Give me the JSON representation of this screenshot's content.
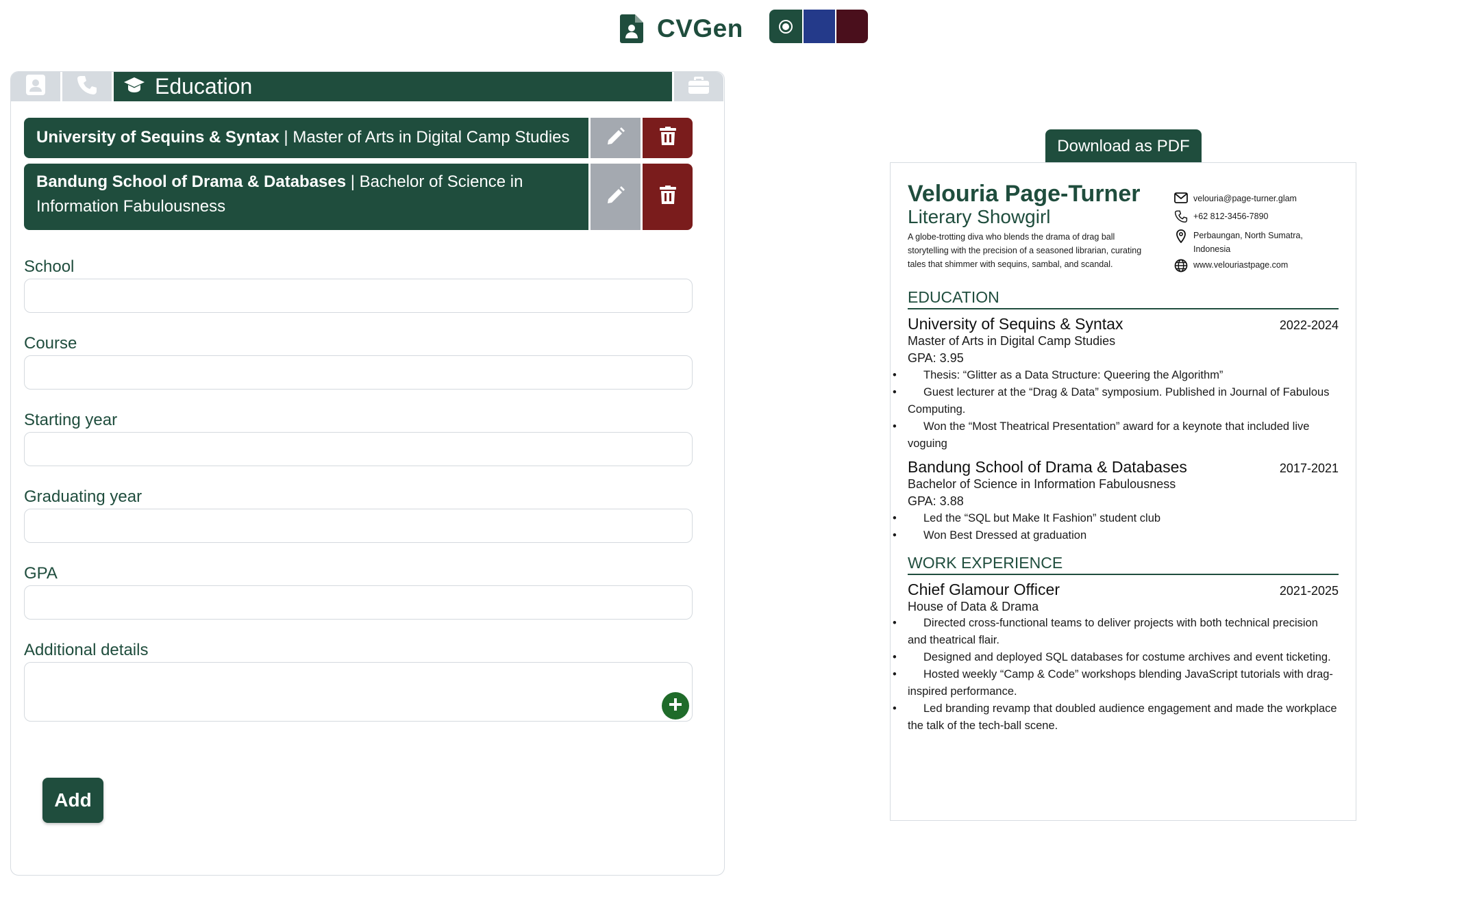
{
  "app": {
    "title": "CVGen",
    "icon": "file-person-icon",
    "themes": [
      {
        "name": "green",
        "color": "#1f4d3d",
        "selected": true
      },
      {
        "name": "blue",
        "color": "#243a8a",
        "selected": false
      },
      {
        "name": "maroon",
        "color": "#4a0f1c",
        "selected": false
      }
    ]
  },
  "editor": {
    "tabs": [
      {
        "id": "personal",
        "icon": "person-card-icon",
        "label": ""
      },
      {
        "id": "contact",
        "icon": "phone-icon",
        "label": ""
      },
      {
        "id": "education",
        "icon": "graduation-cap-icon",
        "label": "Education",
        "active": true
      },
      {
        "id": "work",
        "icon": "briefcase-icon",
        "label": ""
      }
    ],
    "entries": [
      {
        "school": "University of Sequins & Syntax",
        "separator": " | ",
        "course": "Master of Arts in Digital Camp Studies"
      },
      {
        "school": "Bandung School of Drama & Databases",
        "separator": " | ",
        "course": "Bachelor of Science in Information Fabulousness"
      }
    ],
    "form": {
      "school_label": "School",
      "course_label": "Course",
      "start_label": "Starting year",
      "end_label": "Graduating year",
      "gpa_label": "GPA",
      "details_label": "Additional details",
      "school_value": "",
      "course_value": "",
      "start_value": "",
      "end_value": "",
      "gpa_value": ""
    },
    "add_label": "Add"
  },
  "preview": {
    "download_label": "Download as PDF",
    "name": "Velouria Page-Turner",
    "role": "Literary Showgirl",
    "bio": "A globe-trotting diva who blends the drama of drag ball storytelling with the precision of a seasoned librarian, curating tales that shimmer with sequins, sambal, and scandal.",
    "contacts": {
      "email": "velouria@page-turner.glam",
      "phone": "+62 812-3456-7890",
      "location": "Perbaungan, North Sumatra, Indonesia",
      "website": "www.velouriastpage.com"
    },
    "education_heading": "EDUCATION",
    "education": [
      {
        "school": "University of Sequins & Syntax",
        "years": "2022-2024",
        "course": "Master of Arts in Digital Camp Studies",
        "gpa": "GPA: 3.95",
        "details": [
          "Thesis: “Glitter as a Data Structure: Queering the Algorithm”",
          "Guest lecturer at the “Drag & Data” symposium. Published in Journal of Fabulous Computing.",
          "Won the “Most Theatrical Presentation” award for a keynote that included live voguing"
        ]
      },
      {
        "school": "Bandung School of Drama & Databases",
        "years": "2017-2021",
        "course": "Bachelor of Science in Information Fabulousness",
        "gpa": "GPA: 3.88",
        "details": [
          "Led the “SQL but Make It Fashion” student club",
          "Won Best Dressed at graduation"
        ]
      }
    ],
    "work_heading": "WORK EXPERIENCE",
    "work": [
      {
        "title": "Chief Glamour Officer",
        "years": "2021-2025",
        "company": "House of Data & Drama",
        "details": [
          "Directed cross-functional teams to deliver projects with both technical precision and theatrical flair.",
          "Designed and deployed SQL databases for costume archives and event ticketing.",
          "Hosted weekly “Camp & Code” workshops blending JavaScript tutorials with drag-inspired performance.",
          "Led branding revamp that doubled audience engagement and made the workplace the talk of the tech-ball scene."
        ]
      }
    ]
  }
}
